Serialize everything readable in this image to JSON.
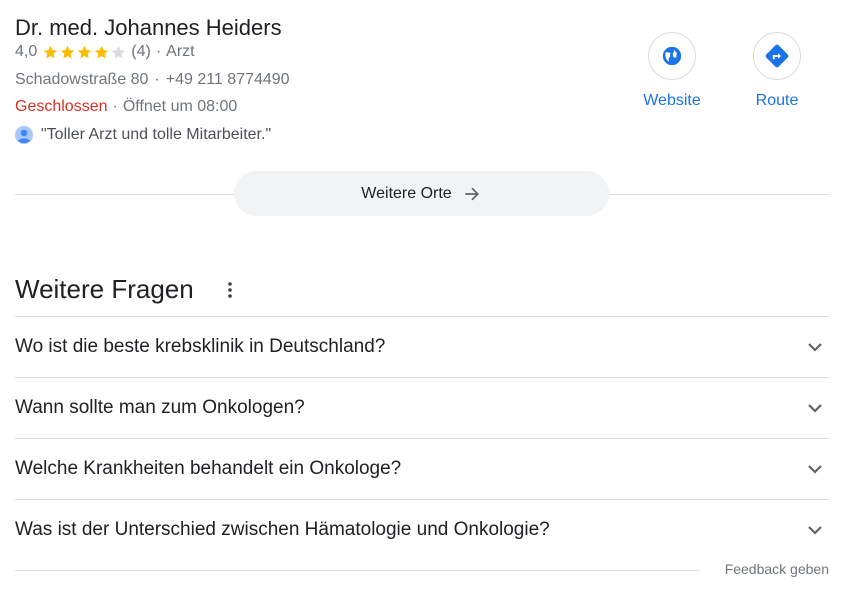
{
  "business": {
    "name": "Dr. med. Johannes Heiders",
    "rating_value": "4,0",
    "rating_stars": 4,
    "rating_max": 5,
    "review_count": "(4)",
    "category_sep": "·",
    "category": "Arzt",
    "address": "Schadowstraße 80",
    "sep": "·",
    "phone": "+49 211 8774490",
    "status": "Geschlossen",
    "status_sep": "·",
    "opens": "Öffnet um 08:00",
    "review_snippet": "\"Toller Arzt und tolle Mitarbeiter.\"",
    "star_color": "#fbbc04",
    "star_empty_color": "#dadce0",
    "status_color": "#d93025"
  },
  "actions": {
    "website": {
      "label": "Website",
      "icon": "globe-icon"
    },
    "route": {
      "label": "Route",
      "icon": "directions-icon"
    },
    "accent": "#1a73e8"
  },
  "more_places": {
    "label": "Weitere Orte",
    "icon": "arrow-right-icon"
  },
  "questions": {
    "title": "Weitere Fragen",
    "items": [
      {
        "text": "Wo ist die beste krebsklinik in Deutschland?"
      },
      {
        "text": "Wann sollte man zum Onkologen?"
      },
      {
        "text": "Welche Krankheiten behandelt ein Onkologe?"
      },
      {
        "text": "Was ist der Unterschied zwischen Hämatologie und Onkologie?"
      }
    ]
  },
  "feedback": {
    "label": "Feedback geben"
  }
}
